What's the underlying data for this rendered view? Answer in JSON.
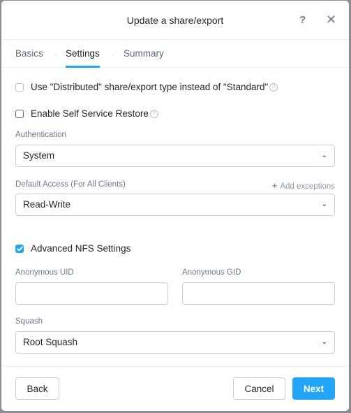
{
  "dialog": {
    "title": "Update a share/export",
    "help_icon": "question-icon",
    "close_icon": "close-icon"
  },
  "tabs": [
    {
      "label": "Basics",
      "active": false
    },
    {
      "label": "Settings",
      "active": true
    },
    {
      "label": "Summary",
      "active": false
    }
  ],
  "settings": {
    "distributed": {
      "label": "Use \"Distributed\" share/export type instead of \"Standard\"",
      "checked": false,
      "disabled": true
    },
    "self_service_restore": {
      "label": "Enable Self Service Restore",
      "checked": false
    },
    "authentication": {
      "label": "Authentication",
      "value": "System"
    },
    "default_access": {
      "label": "Default Access (For All Clients)",
      "value": "Read-Write",
      "add_exceptions": "Add exceptions"
    },
    "advanced_nfs": {
      "label": "Advanced NFS Settings",
      "checked": true
    },
    "anonymous_uid": {
      "label": "Anonymous UID",
      "value": ""
    },
    "anonymous_gid": {
      "label": "Anonymous GID",
      "value": ""
    },
    "squash": {
      "label": "Squash",
      "value": "Root Squash"
    }
  },
  "footer": {
    "back": "Back",
    "cancel": "Cancel",
    "next": "Next"
  },
  "colors": {
    "accent": "#22a5f7",
    "text": "#22272e",
    "muted": "#6b7a8f"
  }
}
